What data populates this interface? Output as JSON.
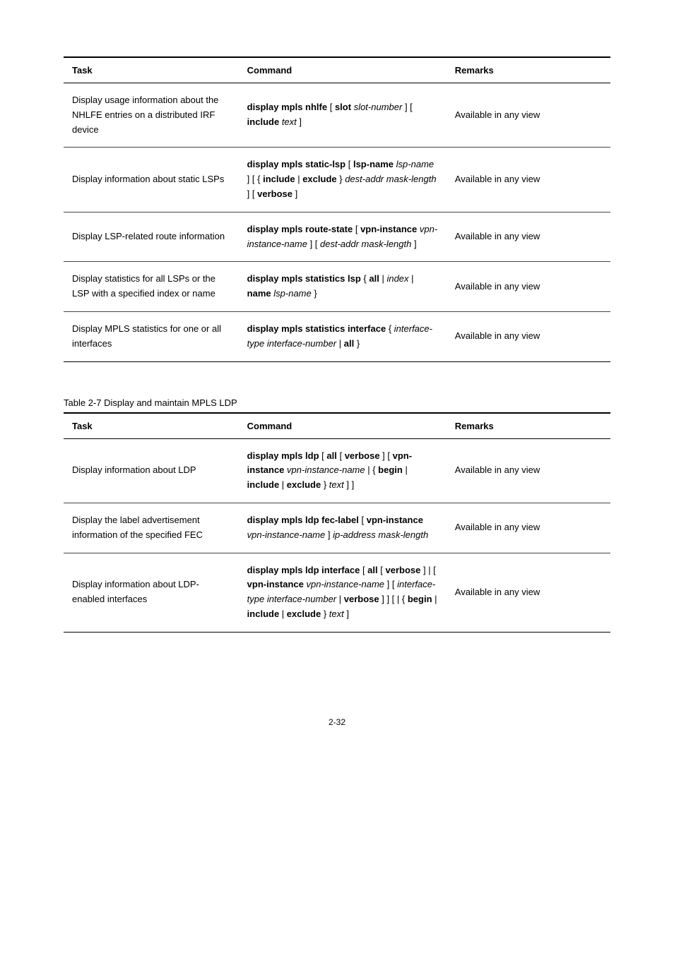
{
  "table1": {
    "headers": {
      "task": "Task",
      "command": "Command",
      "remarks": "Remarks"
    },
    "rows": [
      {
        "task": "Display usage information about the NHLFE entries on a distributed IRF device",
        "cmd_html": "<span class='cmd-bold'>display mpls nhlfe</span> [ <span class='cmd-bold'>slot</span> <span class='cmd-ital'>slot-number</span> ] [ <span class='cmd-bold'>include</span> <span class='cmd-ital'>text</span> ]",
        "remarks": "Available in any view"
      },
      {
        "task": "Display information about static LSPs",
        "cmd_html": "<span class='cmd-bold'>display mpls static-lsp</span> [ <span class='cmd-bold'>lsp-name</span> <span class='cmd-ital'>lsp-name</span> ] [ { <span class='cmd-bold'>include</span> | <span class='cmd-bold'>exclude</span> } <span class='cmd-ital'>dest-addr mask-length</span> ] [ <span class='cmd-bold'>verbose</span> ]",
        "remarks": "Available in any view"
      },
      {
        "task": "Display LSP-related route information",
        "cmd_html": "<span class='cmd-bold'>display mpls route-state</span> [ <span class='cmd-bold'>vpn-instance</span> <span class='cmd-ital'>vpn-instance-name</span> ] [ <span class='cmd-ital'>dest-addr mask-length</span> ]",
        "remarks": "Available in any view"
      },
      {
        "task": "Display statistics for all LSPs or the LSP with a specified index or name",
        "cmd_html": "<span class='cmd-bold'>display mpls statistics lsp</span> { <span class='cmd-bold'>all</span> | <span class='cmd-ital'>index</span> | <span class='cmd-bold'>name</span> <span class='cmd-ital'>lsp-name</span> }",
        "remarks": "Available in any view"
      },
      {
        "task": "Display MPLS statistics for one or all interfaces",
        "cmd_html": "<span class='cmd-bold'>display mpls statistics interface</span> { <span class='cmd-ital'>interface-type interface-number</span> | <span class='cmd-bold'>all</span> }",
        "remarks": "Available in any view"
      }
    ]
  },
  "table2": {
    "label": "Table 2-7 Display and maintain MPLS LDP",
    "headers": {
      "task": "Task",
      "command": "Command",
      "remarks": "Remarks"
    },
    "rows": [
      {
        "task": "Display information about LDP",
        "cmd_html": "<span class='cmd-bold'>display mpls ldp</span> [ <span class='cmd-bold'>all</span> [ <span class='cmd-bold'>verbose</span> ] [ <span class='cmd-bold'>vpn-instance</span> <span class='cmd-ital'>vpn-instance-name</span> | { <span class='cmd-bold'>begin</span> | <span class='cmd-bold'>include</span> | <span class='cmd-bold'>exclude</span> } <span class='cmd-ital'>text</span> ] ]",
        "remarks": "Available in any view"
      },
      {
        "task": "Display the label advertisement information of the specified FEC",
        "cmd_html": "<span class='cmd-bold'>display mpls ldp fec-label</span> [ <span class='cmd-bold'>vpn-instance</span> <span class='cmd-ital'>vpn-instance-name</span> ] <span class='cmd-ital'>ip-address mask-length</span>",
        "remarks": "Available in any view"
      },
      {
        "task": "Display information about LDP-enabled interfaces",
        "cmd_html": "<span class='cmd-bold'>display mpls ldp interface</span> [ <span class='cmd-bold'>all</span> [ <span class='cmd-bold'>verbose</span> ] | [ <span class='cmd-bold'>vpn-instance</span> <span class='cmd-ital'>vpn-instance-name</span> ] [ <span class='cmd-ital'>interface-type interface-number</span> | <span class='cmd-bold'>verbose</span> ] ] [ | { <span class='cmd-bold'>begin</span> | <span class='cmd-bold'>include</span> | <span class='cmd-bold'>exclude</span> } <span class='cmd-ital'>text</span> ]",
        "remarks": "Available in any view"
      }
    ]
  },
  "page_number": "2-32"
}
